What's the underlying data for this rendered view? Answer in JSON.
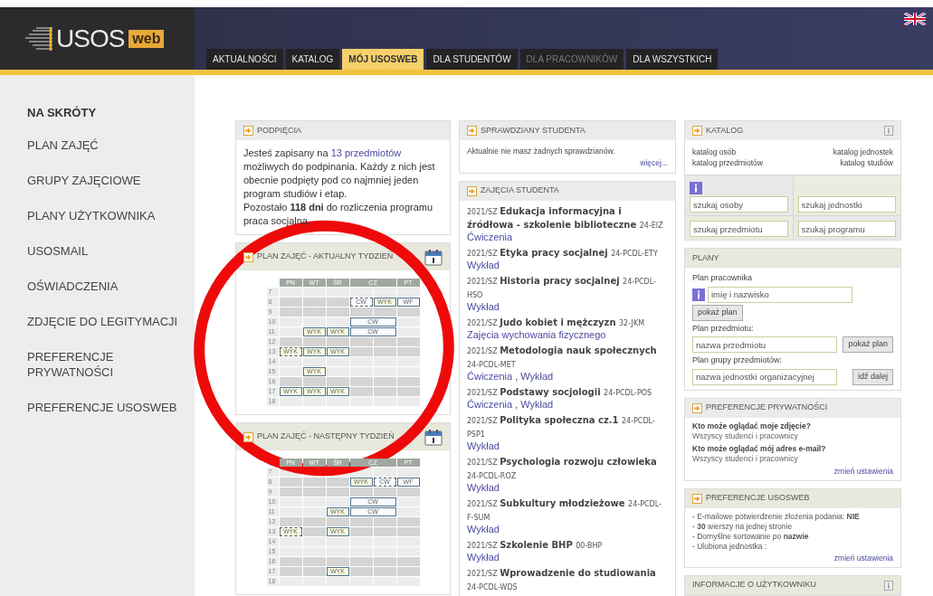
{
  "logo": {
    "text": "USOS",
    "badge": "web"
  },
  "tabs": [
    {
      "label": "AKTUALNOŚCI",
      "selected": false,
      "disabled": false
    },
    {
      "label": "KATALOG",
      "selected": false,
      "disabled": false
    },
    {
      "label": "MÓJ USOSWEB",
      "selected": true,
      "disabled": false
    },
    {
      "label": "DLA STUDENTÓW",
      "selected": false,
      "disabled": false
    },
    {
      "label": "DLA PRACOWNIKÓW",
      "selected": false,
      "disabled": true
    },
    {
      "label": "DLA WSZYSTKICH",
      "selected": false,
      "disabled": false
    }
  ],
  "sidebar": {
    "title": "NA SKRÓTY",
    "items": [
      "PLAN ZAJĘĆ",
      "GRUPY ZAJĘCIOWE",
      "PLANY UŻYTKOWNIKA",
      "USOSMAIL",
      "OŚWIADCZENIA",
      "ZDJĘCIE DO LEGITYMACJI",
      "PREFERENCJE PRYWATNOŚCI",
      "PREFERENCJE USOSWEB"
    ]
  },
  "enrollment": {
    "title": "PODPIĘCIA",
    "before": "Jesteś zapisany na ",
    "link": "13 przedmiotów",
    "after": " możliwych do podpinania. Każdy z nich jest obecnie podpięty pod co najmniej jeden program studiów i etap.",
    "remaining": "Pozostało **118 dni** do rozliczenia programu praca socjalna."
  },
  "timetables": [
    {
      "title": "PLAN ZAJĘĆ - AKTUALNY TYDZIEŃ",
      "days": [
        {
          "label": "PN",
          "wide": false
        },
        {
          "label": "WT",
          "wide": false
        },
        {
          "label": "ŚR",
          "wide": false
        },
        {
          "label": "CZ",
          "wide": true
        },
        {
          "label": "PT",
          "wide": false
        }
      ],
      "rows": [
        {
          "hour": "7",
          "cells": [
            {
              "kind": "free"
            },
            {
              "kind": "free"
            },
            {
              "kind": "free"
            },
            {
              "kind": "free"
            },
            {
              "kind": "free"
            },
            {
              "kind": "free"
            }
          ]
        },
        {
          "hour": "8",
          "cells": [
            {
              "kind": "free"
            },
            {
              "kind": "free"
            },
            {
              "kind": "free"
            },
            {
              "kind": "exercise",
              "label": "CW",
              "dashed": true,
              "wide": false
            },
            {
              "kind": "lecture",
              "label": "WYK",
              "dashed": false,
              "wide": false
            },
            {
              "kind": "exercise",
              "label": "WF",
              "dashed": false,
              "wide": false
            }
          ]
        },
        {
          "hour": "9",
          "cells": [
            {
              "kind": "free"
            },
            {
              "kind": "free"
            },
            {
              "kind": "free"
            },
            {
              "kind": "free"
            },
            {
              "kind": "free"
            },
            {
              "kind": "free"
            }
          ]
        },
        {
          "hour": "10",
          "cells": [
            {
              "kind": "free"
            },
            {
              "kind": "free"
            },
            {
              "kind": "free"
            },
            {
              "kind": "exercise",
              "label": "CW",
              "dashed": false,
              "wide": true
            },
            {
              "kind": "free"
            }
          ]
        },
        {
          "hour": "11",
          "cells": [
            {
              "kind": "free"
            },
            {
              "kind": "lecture",
              "label": "WYK",
              "dashed": false,
              "wide": false
            },
            {
              "kind": "lecture",
              "label": "WYK",
              "dashed": false,
              "wide": false
            },
            {
              "kind": "exercise",
              "label": "CW",
              "dashed": false,
              "wide": true
            },
            {
              "kind": "free"
            }
          ]
        },
        {
          "hour": "12",
          "cells": [
            {
              "kind": "free"
            },
            {
              "kind": "free"
            },
            {
              "kind": "free"
            },
            {
              "kind": "free"
            },
            {
              "kind": "free"
            },
            {
              "kind": "free"
            }
          ]
        },
        {
          "hour": "13",
          "cells": [
            {
              "kind": "lecture",
              "label": "WYK",
              "dashed": true,
              "wide": false
            },
            {
              "kind": "lecture",
              "label": "WYK",
              "dashed": false,
              "wide": false
            },
            {
              "kind": "lecture",
              "label": "WYK",
              "dashed": false,
              "wide": false
            },
            {
              "kind": "free"
            },
            {
              "kind": "free"
            },
            {
              "kind": "free"
            }
          ]
        },
        {
          "hour": "14",
          "cells": [
            {
              "kind": "free"
            },
            {
              "kind": "free"
            },
            {
              "kind": "free"
            },
            {
              "kind": "free"
            },
            {
              "kind": "free"
            },
            {
              "kind": "free"
            }
          ]
        },
        {
          "hour": "15",
          "cells": [
            {
              "kind": "free"
            },
            {
              "kind": "lecture",
              "label": "WYK",
              "dashed": false,
              "wide": false
            },
            {
              "kind": "free"
            },
            {
              "kind": "free"
            },
            {
              "kind": "free"
            },
            {
              "kind": "free"
            }
          ]
        },
        {
          "hour": "16",
          "cells": [
            {
              "kind": "free"
            },
            {
              "kind": "free"
            },
            {
              "kind": "free"
            },
            {
              "kind": "free"
            },
            {
              "kind": "free"
            },
            {
              "kind": "free"
            }
          ]
        },
        {
          "hour": "17",
          "cells": [
            {
              "kind": "lecture",
              "label": "WYK",
              "dashed": false,
              "wide": false
            },
            {
              "kind": "lecture",
              "label": "WYK",
              "dashed": false,
              "wide": false
            },
            {
              "kind": "lecture",
              "label": "WYK",
              "dashed": false,
              "wide": false
            },
            {
              "kind": "free"
            },
            {
              "kind": "free"
            },
            {
              "kind": "free"
            }
          ]
        },
        {
          "hour": "18",
          "cells": [
            {
              "kind": "free"
            },
            {
              "kind": "free"
            },
            {
              "kind": "free"
            },
            {
              "kind": "free"
            },
            {
              "kind": "free"
            },
            {
              "kind": "free"
            }
          ]
        }
      ]
    },
    {
      "title": "PLAN ZAJĘĆ - NASTĘPNY TYDZIEŃ",
      "days": [
        {
          "label": "PN",
          "wide": false
        },
        {
          "label": "WT",
          "wide": false
        },
        {
          "label": "ŚR",
          "wide": false
        },
        {
          "label": "CZ",
          "wide": true
        },
        {
          "label": "PT",
          "wide": false
        }
      ],
      "rows": [
        {
          "hour": "7",
          "cells": [
            {
              "kind": "free"
            },
            {
              "kind": "free"
            },
            {
              "kind": "free"
            },
            {
              "kind": "free"
            },
            {
              "kind": "free"
            },
            {
              "kind": "free"
            }
          ]
        },
        {
          "hour": "8",
          "cells": [
            {
              "kind": "free"
            },
            {
              "kind": "free"
            },
            {
              "kind": "free"
            },
            {
              "kind": "lecture",
              "label": "WYK",
              "dashed": false,
              "wide": false
            },
            {
              "kind": "exercise",
              "label": "CW",
              "dashed": true,
              "wide": false
            },
            {
              "kind": "exercise",
              "label": "WF",
              "dashed": false,
              "wide": false
            }
          ]
        },
        {
          "hour": "9",
          "cells": [
            {
              "kind": "free"
            },
            {
              "kind": "free"
            },
            {
              "kind": "free"
            },
            {
              "kind": "free"
            },
            {
              "kind": "free"
            },
            {
              "kind": "free"
            }
          ]
        },
        {
          "hour": "10",
          "cells": [
            {
              "kind": "free"
            },
            {
              "kind": "free"
            },
            {
              "kind": "free"
            },
            {
              "kind": "exercise",
              "label": "CW",
              "dashed": false,
              "wide": true
            },
            {
              "kind": "free"
            }
          ]
        },
        {
          "hour": "11",
          "cells": [
            {
              "kind": "free"
            },
            {
              "kind": "free"
            },
            {
              "kind": "lecture",
              "label": "WYK",
              "dashed": false,
              "wide": false
            },
            {
              "kind": "exercise",
              "label": "CW",
              "dashed": false,
              "wide": true
            },
            {
              "kind": "free"
            }
          ]
        },
        {
          "hour": "12",
          "cells": [
            {
              "kind": "free"
            },
            {
              "kind": "free"
            },
            {
              "kind": "free"
            },
            {
              "kind": "free"
            },
            {
              "kind": "free"
            },
            {
              "kind": "free"
            }
          ]
        },
        {
          "hour": "13",
          "cells": [
            {
              "kind": "lecture",
              "label": "WYK",
              "dashed": true,
              "wide": false
            },
            {
              "kind": "free"
            },
            {
              "kind": "lecture",
              "label": "WYK",
              "dashed": false,
              "wide": false
            },
            {
              "kind": "free"
            },
            {
              "kind": "free"
            },
            {
              "kind": "free"
            }
          ]
        },
        {
          "hour": "14",
          "cells": [
            {
              "kind": "free"
            },
            {
              "kind": "free"
            },
            {
              "kind": "free"
            },
            {
              "kind": "free"
            },
            {
              "kind": "free"
            },
            {
              "kind": "free"
            }
          ]
        },
        {
          "hour": "15",
          "cells": [
            {
              "kind": "free"
            },
            {
              "kind": "free"
            },
            {
              "kind": "free"
            },
            {
              "kind": "free"
            },
            {
              "kind": "free"
            },
            {
              "kind": "free"
            }
          ]
        },
        {
          "hour": "16",
          "cells": [
            {
              "kind": "free"
            },
            {
              "kind": "free"
            },
            {
              "kind": "free"
            },
            {
              "kind": "free"
            },
            {
              "kind": "free"
            },
            {
              "kind": "free"
            }
          ]
        },
        {
          "hour": "17",
          "cells": [
            {
              "kind": "free"
            },
            {
              "kind": "free"
            },
            {
              "kind": "lecture",
              "label": "WYK",
              "dashed": false,
              "wide": false
            },
            {
              "kind": "free"
            },
            {
              "kind": "free"
            },
            {
              "kind": "free"
            }
          ]
        },
        {
          "hour": "18",
          "cells": [
            {
              "kind": "free"
            },
            {
              "kind": "free"
            },
            {
              "kind": "free"
            },
            {
              "kind": "free"
            },
            {
              "kind": "free"
            },
            {
              "kind": "free"
            }
          ]
        }
      ]
    }
  ],
  "tests": {
    "title": "SPRAWDZIANY STUDENTA",
    "message": "Aktualnie nie masz żadnych sprawdzianów.",
    "more": "więcej..."
  },
  "classes": {
    "title": "ZAJĘCIA STUDENTA",
    "separator": ",",
    "items": [
      {
        "term": "2021/SZ",
        "name": "Edukacja informacyjna i źródłowa - szkolenie biblioteczne",
        "code": "24-EIZ",
        "types": [
          "Ćwiczenia"
        ]
      },
      {
        "term": "2021/SZ",
        "name": "Etyka pracy socjalnej",
        "code": "24-PCDL-ETY",
        "types": [
          "Wykład"
        ]
      },
      {
        "term": "2021/SZ",
        "name": "Historia pracy socjalnej",
        "code": "24-PCDL-HSO",
        "types": [
          "Wykład"
        ]
      },
      {
        "term": "2021/SZ",
        "name": "Judo kobiet i mężczyzn",
        "code": "32-JKM",
        "types": [
          "Zajęcia wychowania fizycznego"
        ]
      },
      {
        "term": "2021/SZ",
        "name": "Metodologia nauk społecznych",
        "code": "24-PCDL-MET",
        "types": [
          "Ćwiczenia",
          "Wykład"
        ]
      },
      {
        "term": "2021/SZ",
        "name": "Podstawy socjologii",
        "code": "24-PCDL-POS",
        "types": [
          "Ćwiczenia",
          "Wykład"
        ]
      },
      {
        "term": "2021/SZ",
        "name": "Polityka społeczna cz.1",
        "code": "24-PCDL-PSP1",
        "types": [
          "Wykład"
        ]
      },
      {
        "term": "2021/SZ",
        "name": "Psychologia rozwoju człowieka",
        "code": "24-PCDL-ROZ",
        "types": [
          "Wykład"
        ]
      },
      {
        "term": "2021/SZ",
        "name": "Subkultury młodzieżowe",
        "code": "24-PCDL-F-SUM",
        "types": [
          "Wykład"
        ]
      },
      {
        "term": "2021/SZ",
        "name": "Szkolenie BHP",
        "code": "00-BHP",
        "types": [
          "Wykład"
        ]
      },
      {
        "term": "2021/SZ",
        "name": "Wprowadzenie do studiowania",
        "code": "24-PCDL-WDS"
      }
    ]
  },
  "catalog": {
    "title": "KATALOG",
    "links": [
      "katalog osób",
      "katalog jednostek",
      "katalog przedmiotów",
      "katalog studiów"
    ],
    "searches": [
      {
        "placeholder": "szukaj osoby"
      },
      {
        "placeholder": "szukaj jednostki"
      },
      {
        "placeholder": "szukaj przedmiotu"
      },
      {
        "placeholder": "szukaj programu"
      }
    ]
  },
  "plans": {
    "title": "PLANY",
    "employee_label": "Plan pracownika",
    "employee_placeholder": "imię i nazwisko",
    "employee_button": "pokaż plan",
    "course_label": "Plan przedmiotu:",
    "course_placeholder": "nazwa przedmiotu",
    "course_button": "pokaż plan",
    "group_label": "Plan grupy przedmiotów:",
    "group_placeholder": "nazwa jednostki organizacyjnej",
    "group_button": "idź dalej"
  },
  "privacy": {
    "title": "PREFERENCJE PRYWATNOŚCI",
    "items": [
      {
        "question": "Kto może oglądać moje zdjęcie?",
        "answer": "Wszyscy studenci i pracownicy"
      },
      {
        "question": "Kto może oglądać mój adres e-mail?",
        "answer": "Wszyscy studenci i pracownicy"
      }
    ],
    "link": "zmień ustawienia"
  },
  "preferences": {
    "title": "PREFERENCJE USOSWEB",
    "lines": [
      "- E-mailowe potwierdzenie złożenia podania: **NIE**",
      "- **30** wierszy na jednej stronie",
      "- Domyślne sortowanie po **nazwie**",
      "- Ulubiona jednostka :"
    ],
    "link": "zmień ustawienia"
  },
  "user_info": {
    "title": "INFORMACJE O UŻYTKOWNIKU"
  }
}
